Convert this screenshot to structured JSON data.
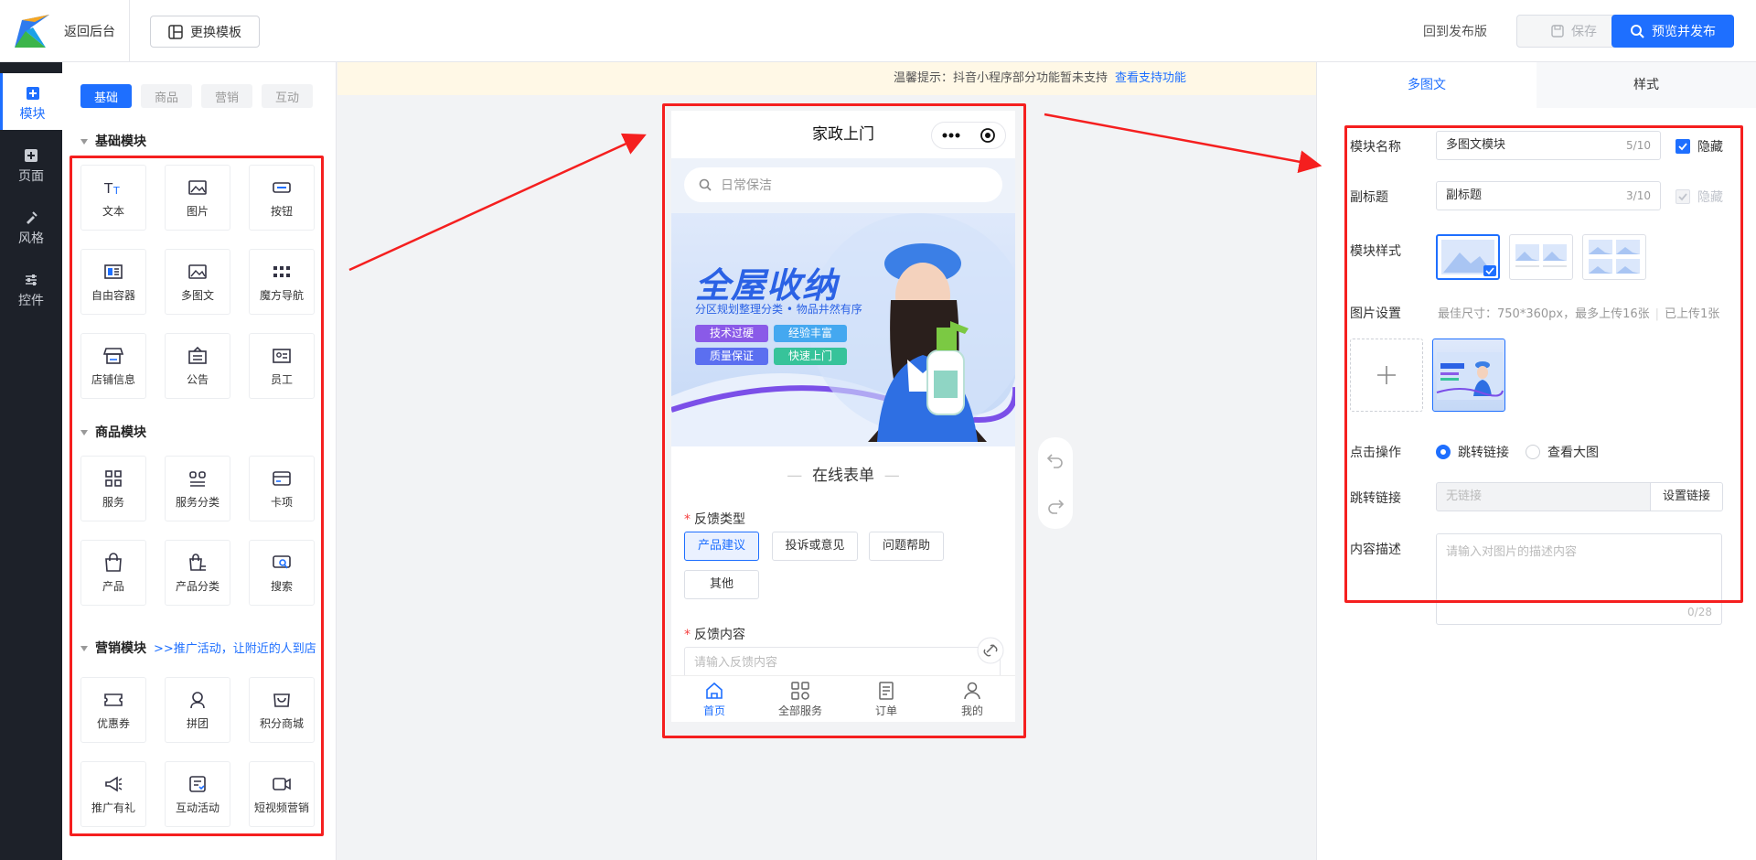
{
  "header": {
    "back_label": "返回后台",
    "template_label": "更换模板",
    "return_release_label": "回到发布版",
    "save_label": "保存",
    "publish_label": "预览并发布"
  },
  "nav": [
    {
      "label": "模块",
      "icon": "plus-square-icon",
      "active": true
    },
    {
      "label": "页面",
      "icon": "plus-square-icon",
      "active": false
    },
    {
      "label": "风格",
      "icon": "brush-icon",
      "active": false
    },
    {
      "label": "控件",
      "icon": "sliders-icon",
      "active": false
    }
  ],
  "left_panel": {
    "tabs": [
      "基础",
      "商品",
      "营销",
      "互动"
    ],
    "basic_title": "基础模块",
    "basic_items": [
      "文本",
      "图片",
      "按钮",
      "自由容器",
      "多图文",
      "魔方导航",
      "店铺信息",
      "公告",
      "员工"
    ],
    "goods_title": "商品模块",
    "goods_items": [
      "服务",
      "服务分类",
      "卡项",
      "产品",
      "产品分类",
      "搜索"
    ],
    "marketing_title": "营销模块",
    "marketing_promo": ">>推广活动，让附近的人到店",
    "marketing_items": [
      "优惠券",
      "拼团",
      "积分商城",
      "推广有礼",
      "互动活动",
      "短视频营销"
    ]
  },
  "notice": {
    "text": "温馨提示：抖音小程序部分功能暂未支持",
    "link": "查看支持功能"
  },
  "phone": {
    "title": "家政上门",
    "search_placeholder": "日常保洁",
    "banner_title": "全屋收纳",
    "banner_subtitle": "分区规划整理分类 • 物品井然有序",
    "banner_tags": [
      "技术过硬",
      "经验丰富",
      "质量保证",
      "快速上门"
    ],
    "form_title": "在线表单",
    "feedback_type_label": "反馈类型",
    "feedback_options": [
      "产品建议",
      "投诉或意见",
      "问题帮助",
      "其他"
    ],
    "feedback_content_label": "反馈内容",
    "feedback_placeholder": "请输入反馈内容",
    "tabbar": [
      "首页",
      "全部服务",
      "订单",
      "我的"
    ]
  },
  "right_panel": {
    "tabs": [
      "多图文",
      "样式"
    ],
    "module_name_label": "模块名称",
    "module_name_value": "多图文模块",
    "module_name_count": "5/10",
    "hide_label": "隐藏",
    "subtitle_label": "副标题",
    "subtitle_value": "副标题",
    "subtitle_count": "3/10",
    "subtitle_hide_label": "隐藏",
    "style_label": "模块样式",
    "image_label": "图片设置",
    "image_hint": "最佳尺寸：750*360px，最多上传16张",
    "image_uploaded": "已上传1张",
    "click_label": "点击操作",
    "click_options": [
      "跳转链接",
      "查看大图"
    ],
    "link_label": "跳转链接",
    "link_placeholder": "无链接",
    "link_button": "设置链接",
    "desc_label": "内容描述",
    "desc_placeholder": "请输入对图片的描述内容",
    "desc_count": "0/28"
  },
  "colors": {
    "primary": "#1e6fff",
    "highlight": "#f51f1f",
    "nav_bg": "#1d2129"
  }
}
